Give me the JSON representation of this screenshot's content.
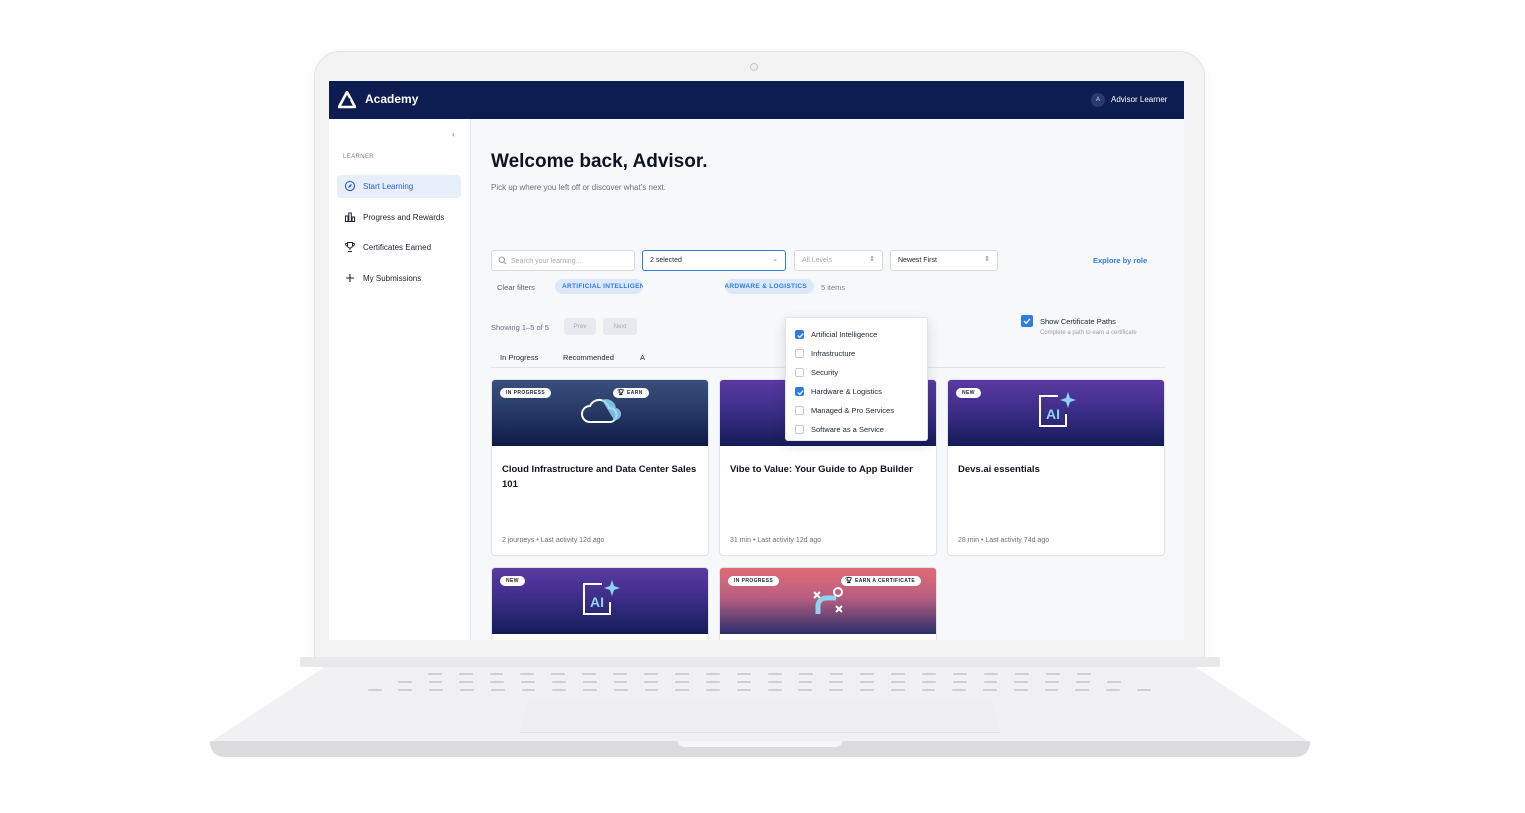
{
  "app": {
    "name": "Academy"
  },
  "user": {
    "initial": "A",
    "name": "Advisor Learner"
  },
  "sidebar": {
    "collapse_glyph": "‹",
    "section_label": "LEARNER",
    "items": [
      {
        "label": "Start Learning",
        "icon": "compass-icon",
        "active": true
      },
      {
        "label": "Progress and Rewards",
        "icon": "bar-chart-icon",
        "active": false
      },
      {
        "label": "Certificates Earned",
        "icon": "trophy-icon",
        "active": false
      },
      {
        "label": "My Submissions",
        "icon": "plus-icon",
        "active": false
      }
    ]
  },
  "main": {
    "welcome": "Welcome back, Advisor.",
    "subtitle": "Pick up where you left off or discover what’s next."
  },
  "filters": {
    "search_placeholder": "Search your learning...",
    "category_value": "2 selected",
    "level_value": "All Levels",
    "sort_value": "Newest First",
    "explore_link": "Explore by role",
    "clear_label": "Clear filters",
    "chips": [
      {
        "label": "ARTIFICIAL INTELLIGENCE ×"
      },
      {
        "label": "HARDWARE & LOGISTICS ×"
      }
    ],
    "items_count": "5 items"
  },
  "pagination": {
    "showing": "Showing 1–5 of 5",
    "prev": "Prev",
    "next": "Next"
  },
  "cert_paths": {
    "checked": true,
    "label": "Show Certificate Paths",
    "sublabel": "Complete a path to earn a certificate"
  },
  "tabs": [
    {
      "label": "In Progress"
    },
    {
      "label": "Recommended"
    },
    {
      "label": "A"
    }
  ],
  "dropdown": {
    "options": [
      {
        "label": "Artificial Intelligence",
        "checked": true
      },
      {
        "label": "Infrastructure",
        "checked": false
      },
      {
        "label": "Security",
        "checked": false
      },
      {
        "label": "Hardware & Logistics",
        "checked": true
      },
      {
        "label": "Managed & Pro Services",
        "checked": false
      },
      {
        "label": "Software as a Service",
        "checked": false
      }
    ]
  },
  "cards": [
    {
      "badge": "IN PROGRESS",
      "earn": "EARN",
      "title": "Cloud Infrastructure and Data Center Sales 101",
      "meta": "2 journeys • Last activity 12d ago",
      "art": "cloud-icon"
    },
    {
      "badge": "",
      "earn": "",
      "title": "Vibe to Value: Your Guide to App Builder",
      "meta": "31 min • Last activity 12d ago",
      "art": "ai-sparkle-icon",
      "art_text": "AI"
    },
    {
      "badge": "NEW",
      "earn": "",
      "title": "Devs.ai essentials",
      "meta": "28 min • Last activity 74d ago",
      "art": "ai-sparkle-icon",
      "art_text": "AI"
    },
    {
      "badge": "NEW",
      "earn": "",
      "title": "",
      "meta": "",
      "art": "ai-sparkle-icon",
      "art_text": "AI"
    },
    {
      "badge": "IN PROGRESS",
      "earn": "EARN A CERTIFICATE",
      "title": "",
      "meta": "",
      "art": "route-icon"
    }
  ],
  "colors": {
    "navy": "#0d1d52",
    "accent": "#2d7be5",
    "active_bg": "#e8eefc"
  }
}
